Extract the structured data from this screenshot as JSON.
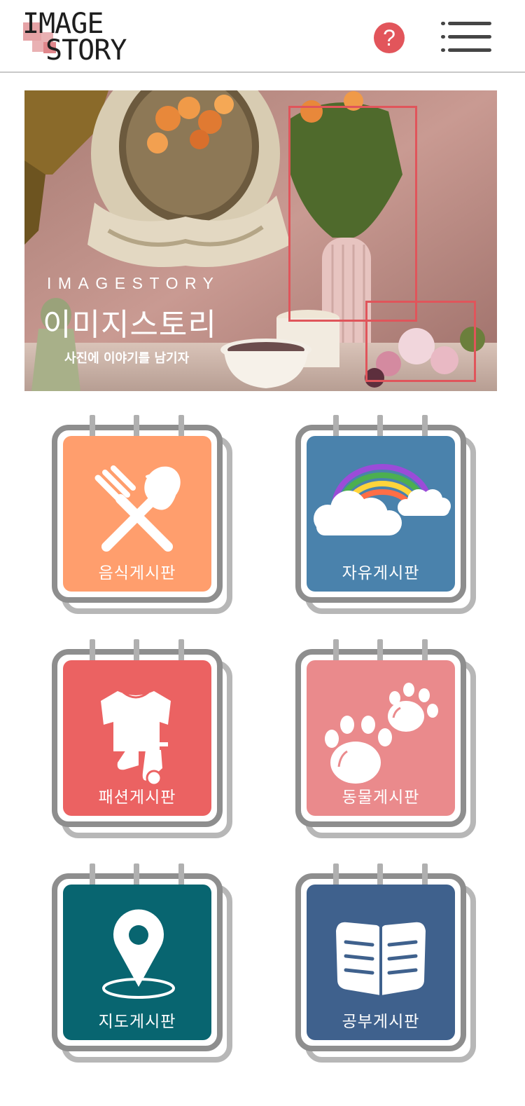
{
  "header": {
    "logo": {
      "line1": "IMAGE",
      "line2": "STORY"
    },
    "help_label": "?",
    "menu_icon": "hamburger-menu-icon"
  },
  "banner": {
    "title_en": "IMAGESTORY",
    "title_ko": "이미지스토리",
    "subtitle": "사진에 이야기를 남기자"
  },
  "boards": [
    {
      "label": "음식게시판",
      "icon": "fork-spoon-icon",
      "color": "#ff9e6d"
    },
    {
      "label": "자유게시판",
      "icon": "rainbow-cloud-icon",
      "color": "#4a82ac"
    },
    {
      "label": "패션게시판",
      "icon": "clothes-icon",
      "color": "#eb6262"
    },
    {
      "label": "동물게시판",
      "icon": "paw-print-icon",
      "color": "#ea8a8c"
    },
    {
      "label": "지도게시판",
      "icon": "map-pin-icon",
      "color": "#086570"
    },
    {
      "label": "공부게시판",
      "icon": "open-book-icon",
      "color": "#3f618d"
    }
  ],
  "colors": {
    "accent": "#e2555b",
    "frame_gray": "#8e8e8e",
    "shadow_gray": "#b7b7b7"
  }
}
